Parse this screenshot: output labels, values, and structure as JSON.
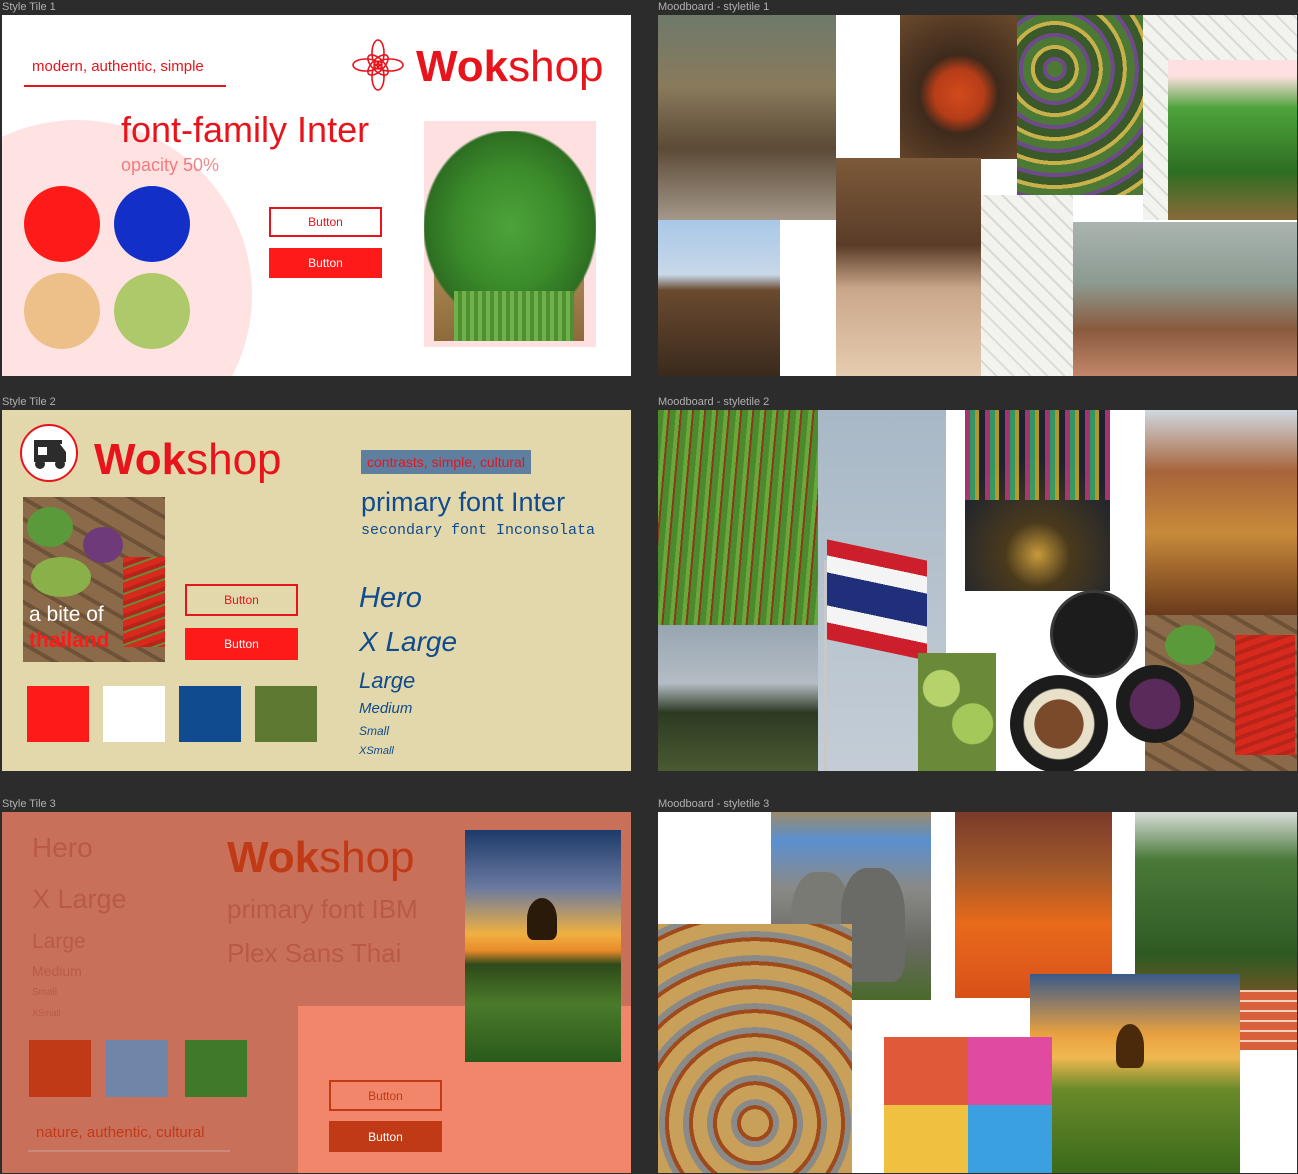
{
  "frames": {
    "style_tile_1": "Style Tile 1",
    "moodboard_1": "Moodboard - styletile 1",
    "style_tile_2": "Style Tile 2",
    "moodboard_2": "Moodboard - styletile 2",
    "style_tile_3": "Style Tile 3",
    "moodboard_3": "Moodboard - styletile 3"
  },
  "tile1": {
    "tagline": "modern, authentic, simple",
    "logo_bold": "Wok",
    "logo_light": "shop",
    "font_heading": "font-family Inter",
    "opacity_note": "opacity 50%",
    "button_outline": "Button",
    "button_filled": "Button",
    "colors": {
      "red": "#ff1a1a",
      "blue": "#1230c8",
      "tan": "#ecc088",
      "green": "#adc96a",
      "blush": "#ffe2e2"
    }
  },
  "tile2": {
    "logo_bold": "Wok",
    "logo_light": "shop",
    "tagline": "contrasts, simple, cultural",
    "primary_font": "primary font Inter",
    "secondary_font": "secondary font Inconsolata",
    "photo_line1": "a bite of",
    "photo_line2": "thailand",
    "button_outline": "Button",
    "button_filled": "Button",
    "type_scale": [
      "Hero",
      "X Large",
      "Large",
      "Medium",
      "Small",
      "XSmall"
    ],
    "colors": {
      "bg": "#e3d8ac",
      "red": "#ff1a1a",
      "white": "#ffffff",
      "navy": "#0f4b8e",
      "olive": "#5e7a32"
    }
  },
  "tile3": {
    "type_scale": [
      "Hero",
      "X Large",
      "Large",
      "Medium",
      "Small",
      "XSmall"
    ],
    "logo_bold": "Wok",
    "logo_light": "shop",
    "primary_font_line1": "primary font IBM",
    "primary_font_line2": "Plex Sans Thai",
    "tagline": "nature, authentic, cultural",
    "button_outline": "Button",
    "button_filled": "Button",
    "colors": {
      "bg": "#c9705b",
      "panel": "#f2866a",
      "rust": "#c13a16",
      "slate": "#6f86a8",
      "green": "#3f7a2a"
    }
  }
}
